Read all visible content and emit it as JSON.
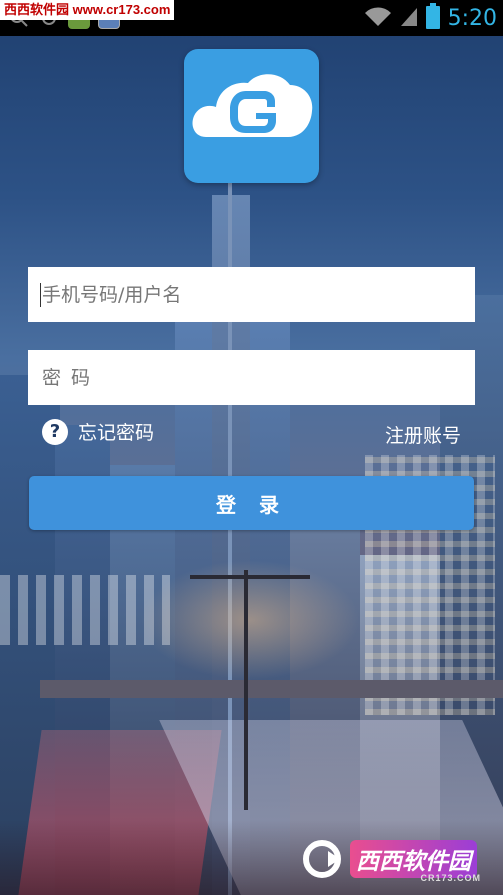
{
  "status_bar": {
    "watermark": "西西软件园 www.cr173.com",
    "time": "5:20"
  },
  "login": {
    "username_placeholder": "手机号码/用户名",
    "password_placeholder": "密 码",
    "forgot_password": "忘记密码",
    "register": "注册账号",
    "submit": "登 录"
  },
  "watermark_bottom": {
    "brand": "西西软件园",
    "domain": "CR173.COM"
  },
  "colors": {
    "accent": "#3f92dc",
    "logo_bg": "#3a9ee2",
    "clock": "#33b5e5"
  }
}
